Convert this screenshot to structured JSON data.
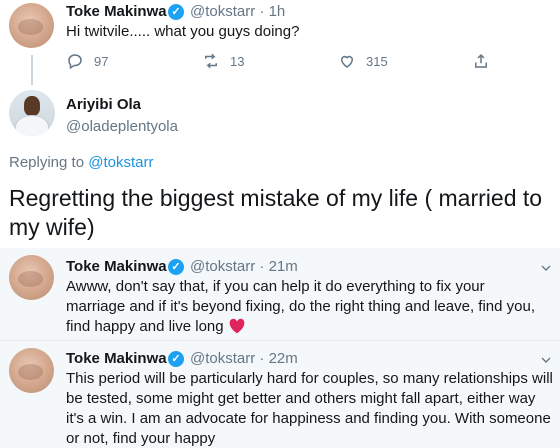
{
  "top_tweet": {
    "name": "Toke Makinwa",
    "handle": "@tokstarr",
    "time": "· 1h",
    "text": "Hi twitvile..... what you guys doing?",
    "replies": "97",
    "retweets": "13",
    "likes": "315"
  },
  "main_tweet": {
    "name": "Ariyibi Ola",
    "handle": "@oladeplentyola",
    "replying_prefix": "Replying to",
    "replying_to": "@tokstarr",
    "text": "Regretting the biggest mistake of my life ( married to my wife)"
  },
  "replies": [
    {
      "name": "Toke Makinwa",
      "handle": "@tokstarr",
      "time": "· 21m",
      "text": "Awww, don't say that, if you can help it do everything to fix your marriage and if it's beyond fixing, do the right thing and leave, find you, find happy and live long"
    },
    {
      "name": "Toke Makinwa",
      "handle": "@tokstarr",
      "time": "· 22m",
      "text": "This period will be particularly hard for couples, so many relationships will be tested, some might get better and others might fall apart, either way it's a win. I am an advocate for happiness and finding you. With someone or not, find your happy"
    }
  ],
  "colors": {
    "accent": "#1da1f2",
    "link": "#1b95e0",
    "muted": "#657786",
    "heart": "#e0245e"
  }
}
